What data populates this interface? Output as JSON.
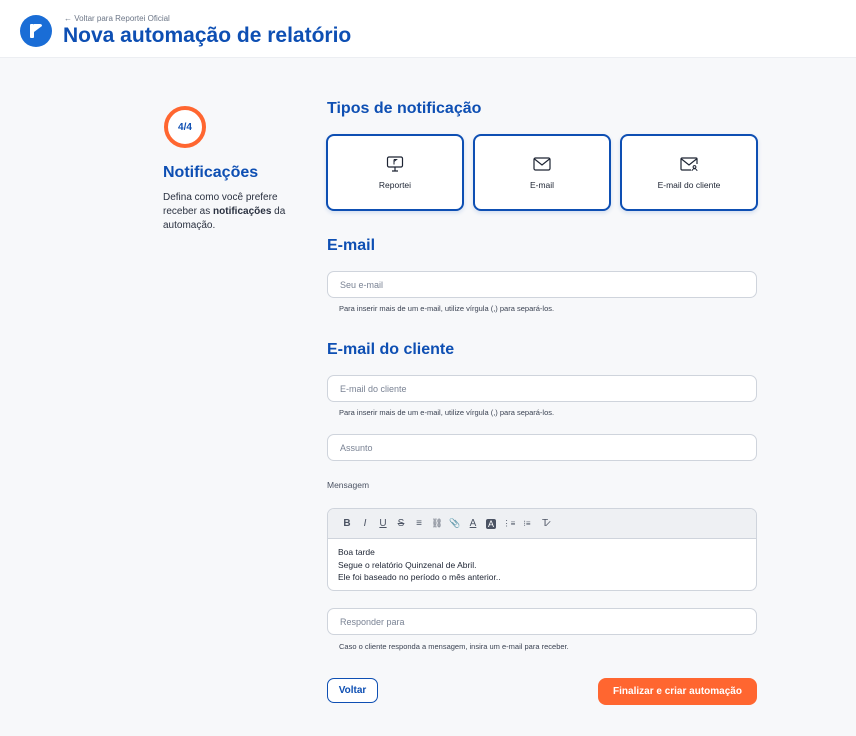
{
  "header": {
    "back_link": "← Voltar para Reportei Oficial",
    "title": "Nova automação de relatório"
  },
  "step": {
    "indicator": "4/4",
    "title": "Notificações",
    "desc_before": "Defina como você prefere receber as ",
    "desc_bold": "notificações",
    "desc_after": " da automação."
  },
  "notification_types": {
    "title": "Tipos de notificação",
    "options": [
      {
        "label": "Reportei",
        "icon": "monitor-icon"
      },
      {
        "label": "E-mail",
        "icon": "mail-icon"
      },
      {
        "label": "E-mail do cliente",
        "icon": "mail-user-icon"
      }
    ]
  },
  "email": {
    "title": "E-mail",
    "placeholder": "Seu e-mail",
    "value": "",
    "hint": "Para inserir mais de um e-mail, utilize vírgula (,) para separá-los."
  },
  "client_email": {
    "title": "E-mail do cliente",
    "placeholder": "E-mail do cliente",
    "value": "",
    "hint": "Para inserir mais de um e-mail, utilize vírgula (,) para separá-los.",
    "subject_placeholder": "Assunto",
    "message_label": "Mensagem",
    "message_lines": [
      "Boa tarde",
      "Segue o relatório Quinzenal de Abril.",
      "Ele foi baseado no período o mês anterior.."
    ],
    "reply_to_placeholder": "Responder para",
    "reply_hint": "Caso o cliente responda a mensagem, insira um e-mail para receber."
  },
  "toolbar": {
    "bold": "B",
    "italic": "I",
    "underline": "U",
    "strike": "S",
    "align": "≡",
    "link": "⛓",
    "attach": "📎",
    "text_color": "A",
    "bg_color": "A",
    "ordered_list": "⋮≡",
    "bullet_list": "⁝≡",
    "clear": "T̷"
  },
  "actions": {
    "back": "Voltar",
    "finish": "Finalizar e criar automação"
  },
  "colors": {
    "brand_blue": "#0e4fb3",
    "accent_orange": "#ff6630"
  }
}
